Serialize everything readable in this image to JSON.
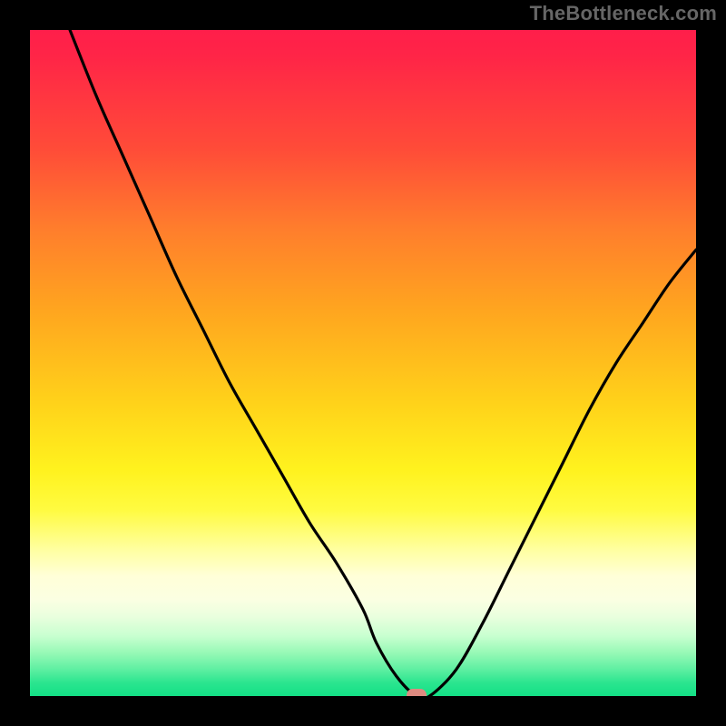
{
  "watermark": "TheBottleneck.com",
  "chart_data": {
    "type": "line",
    "title": "",
    "xlabel": "",
    "ylabel": "",
    "xlim": [
      0,
      100
    ],
    "ylim": [
      0,
      100
    ],
    "legend": false,
    "grid": false,
    "background_gradient": {
      "direction": "vertical",
      "stops": [
        {
          "pos": 0,
          "color": "#ff1e4a"
        },
        {
          "pos": 18,
          "color": "#ff4c38"
        },
        {
          "pos": 42,
          "color": "#ffa51f"
        },
        {
          "pos": 66,
          "color": "#fff21e"
        },
        {
          "pos": 82,
          "color": "#ffffd8"
        },
        {
          "pos": 92,
          "color": "#b6ffc6"
        },
        {
          "pos": 100,
          "color": "#13e086"
        }
      ]
    },
    "series": [
      {
        "name": "bottleneck-curve",
        "color": "#000000",
        "x": [
          6,
          10,
          14,
          18,
          22,
          26,
          30,
          34,
          38,
          42,
          46,
          50,
          52,
          55,
          58,
          60,
          64,
          68,
          72,
          76,
          80,
          84,
          88,
          92,
          96,
          100
        ],
        "y": [
          100,
          90,
          81,
          72,
          63,
          55,
          47,
          40,
          33,
          26,
          20,
          13,
          8,
          3,
          0,
          0,
          4,
          11,
          19,
          27,
          35,
          43,
          50,
          56,
          62,
          67
        ]
      }
    ],
    "marker": {
      "name": "optimal-point",
      "x": 58,
      "y": 0,
      "color": "#dd8a80"
    }
  }
}
